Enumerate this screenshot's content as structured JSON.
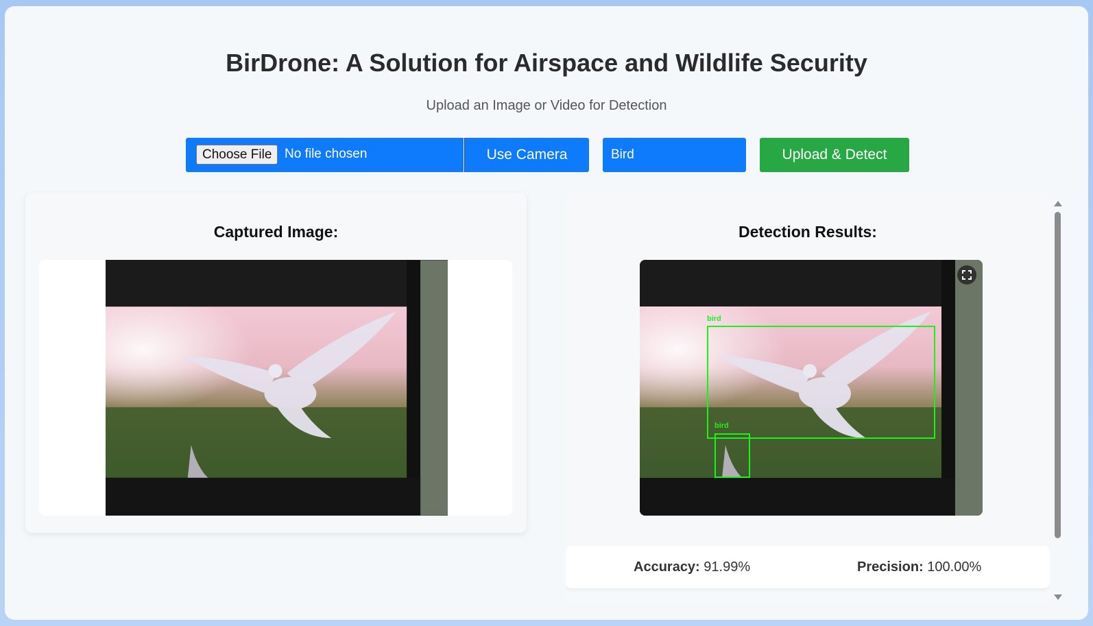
{
  "header": {
    "title": "BirDrone: A Solution for Airspace and Wildlife Security",
    "subtitle": "Upload an Image or Video for Detection"
  },
  "controls": {
    "choose_file_label": "Choose File",
    "file_status": "No file chosen",
    "camera_label": "Use Camera",
    "class_selected": "Bird",
    "detect_label": "Upload & Detect"
  },
  "captured": {
    "heading": "Captured Image:"
  },
  "results": {
    "heading": "Detection Results:",
    "detections": [
      {
        "label": "bird"
      },
      {
        "label": "bird"
      }
    ],
    "accuracy_label": "Accuracy:",
    "accuracy_value": "91.99%",
    "precision_label": "Precision:",
    "precision_value": "100.00%"
  },
  "colors": {
    "primary": "#0d7bfb",
    "success": "#28a745",
    "detection_box": "#1bf21b"
  }
}
